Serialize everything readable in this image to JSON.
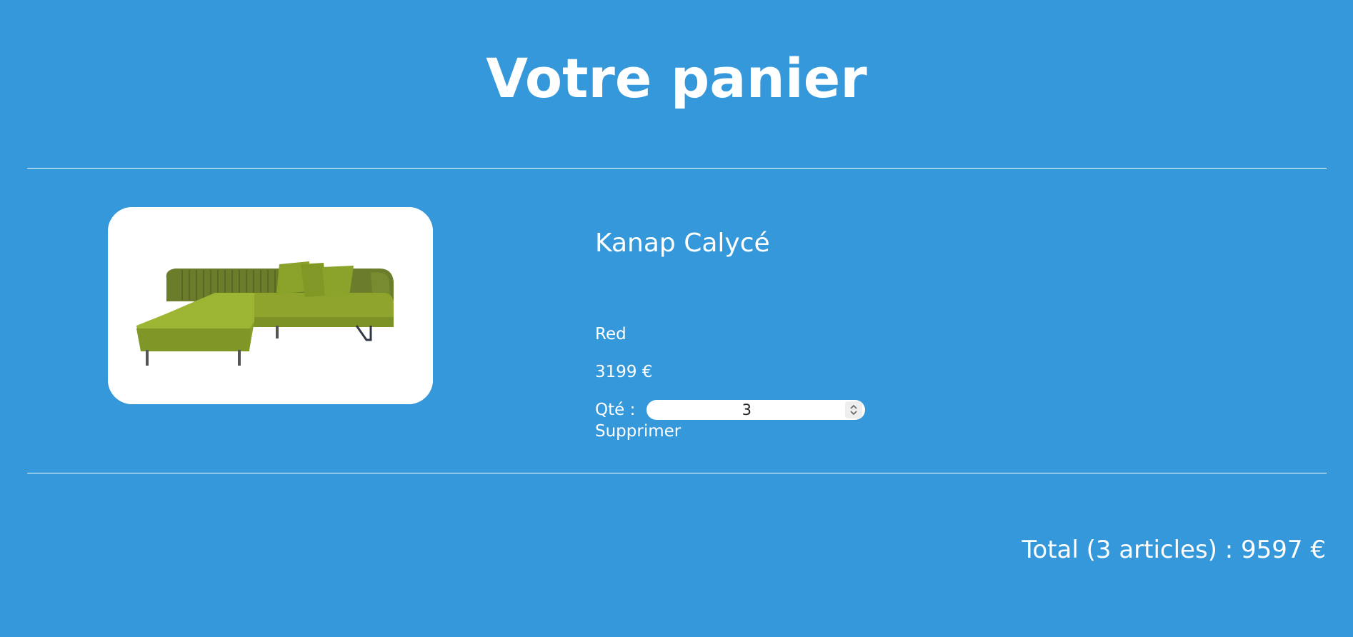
{
  "page": {
    "title": "Votre panier",
    "background_color": "#3498db"
  },
  "cart_item": {
    "image_icon": "green-sofa-product-image",
    "name": "Kanap Calycé",
    "color": "Red",
    "price": "3199 €",
    "quantity_label": "Qté :",
    "quantity_value": "3",
    "delete_label": "Supprimer"
  },
  "summary": {
    "total_text": "Total (3 articles) : 9597 €"
  }
}
